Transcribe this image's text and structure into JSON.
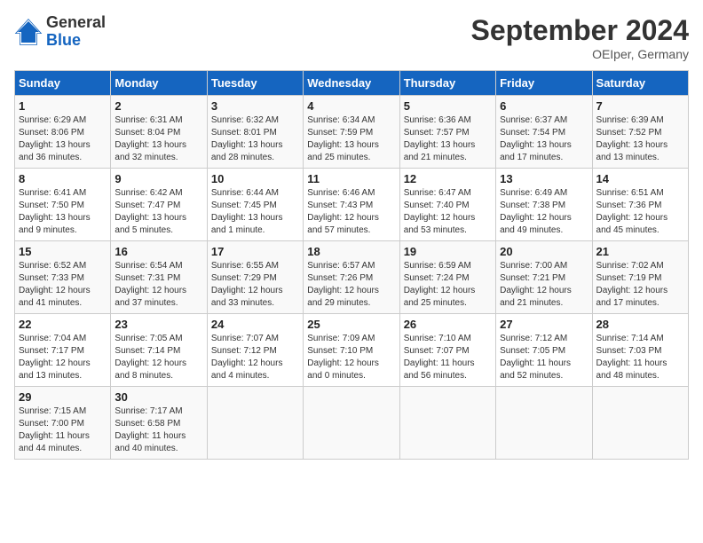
{
  "header": {
    "logo_line1": "General",
    "logo_line2": "Blue",
    "title": "September 2024",
    "subtitle": "OEIper, Germany"
  },
  "weekdays": [
    "Sunday",
    "Monday",
    "Tuesday",
    "Wednesday",
    "Thursday",
    "Friday",
    "Saturday"
  ],
  "weeks": [
    [
      {
        "day": "1",
        "sunrise": "6:29 AM",
        "sunset": "8:06 PM",
        "daylight": "13 hours and 36 minutes."
      },
      {
        "day": "2",
        "sunrise": "6:31 AM",
        "sunset": "8:04 PM",
        "daylight": "13 hours and 32 minutes."
      },
      {
        "day": "3",
        "sunrise": "6:32 AM",
        "sunset": "8:01 PM",
        "daylight": "13 hours and 28 minutes."
      },
      {
        "day": "4",
        "sunrise": "6:34 AM",
        "sunset": "7:59 PM",
        "daylight": "13 hours and 25 minutes."
      },
      {
        "day": "5",
        "sunrise": "6:36 AM",
        "sunset": "7:57 PM",
        "daylight": "13 hours and 21 minutes."
      },
      {
        "day": "6",
        "sunrise": "6:37 AM",
        "sunset": "7:54 PM",
        "daylight": "13 hours and 17 minutes."
      },
      {
        "day": "7",
        "sunrise": "6:39 AM",
        "sunset": "7:52 PM",
        "daylight": "13 hours and 13 minutes."
      }
    ],
    [
      {
        "day": "8",
        "sunrise": "6:41 AM",
        "sunset": "7:50 PM",
        "daylight": "13 hours and 9 minutes."
      },
      {
        "day": "9",
        "sunrise": "6:42 AM",
        "sunset": "7:47 PM",
        "daylight": "13 hours and 5 minutes."
      },
      {
        "day": "10",
        "sunrise": "6:44 AM",
        "sunset": "7:45 PM",
        "daylight": "13 hours and 1 minute."
      },
      {
        "day": "11",
        "sunrise": "6:46 AM",
        "sunset": "7:43 PM",
        "daylight": "12 hours and 57 minutes."
      },
      {
        "day": "12",
        "sunrise": "6:47 AM",
        "sunset": "7:40 PM",
        "daylight": "12 hours and 53 minutes."
      },
      {
        "day": "13",
        "sunrise": "6:49 AM",
        "sunset": "7:38 PM",
        "daylight": "12 hours and 49 minutes."
      },
      {
        "day": "14",
        "sunrise": "6:51 AM",
        "sunset": "7:36 PM",
        "daylight": "12 hours and 45 minutes."
      }
    ],
    [
      {
        "day": "15",
        "sunrise": "6:52 AM",
        "sunset": "7:33 PM",
        "daylight": "12 hours and 41 minutes."
      },
      {
        "day": "16",
        "sunrise": "6:54 AM",
        "sunset": "7:31 PM",
        "daylight": "12 hours and 37 minutes."
      },
      {
        "day": "17",
        "sunrise": "6:55 AM",
        "sunset": "7:29 PM",
        "daylight": "12 hours and 33 minutes."
      },
      {
        "day": "18",
        "sunrise": "6:57 AM",
        "sunset": "7:26 PM",
        "daylight": "12 hours and 29 minutes."
      },
      {
        "day": "19",
        "sunrise": "6:59 AM",
        "sunset": "7:24 PM",
        "daylight": "12 hours and 25 minutes."
      },
      {
        "day": "20",
        "sunrise": "7:00 AM",
        "sunset": "7:21 PM",
        "daylight": "12 hours and 21 minutes."
      },
      {
        "day": "21",
        "sunrise": "7:02 AM",
        "sunset": "7:19 PM",
        "daylight": "12 hours and 17 minutes."
      }
    ],
    [
      {
        "day": "22",
        "sunrise": "7:04 AM",
        "sunset": "7:17 PM",
        "daylight": "12 hours and 13 minutes."
      },
      {
        "day": "23",
        "sunrise": "7:05 AM",
        "sunset": "7:14 PM",
        "daylight": "12 hours and 8 minutes."
      },
      {
        "day": "24",
        "sunrise": "7:07 AM",
        "sunset": "7:12 PM",
        "daylight": "12 hours and 4 minutes."
      },
      {
        "day": "25",
        "sunrise": "7:09 AM",
        "sunset": "7:10 PM",
        "daylight": "12 hours and 0 minutes."
      },
      {
        "day": "26",
        "sunrise": "7:10 AM",
        "sunset": "7:07 PM",
        "daylight": "11 hours and 56 minutes."
      },
      {
        "day": "27",
        "sunrise": "7:12 AM",
        "sunset": "7:05 PM",
        "daylight": "11 hours and 52 minutes."
      },
      {
        "day": "28",
        "sunrise": "7:14 AM",
        "sunset": "7:03 PM",
        "daylight": "11 hours and 48 minutes."
      }
    ],
    [
      {
        "day": "29",
        "sunrise": "7:15 AM",
        "sunset": "7:00 PM",
        "daylight": "11 hours and 44 minutes."
      },
      {
        "day": "30",
        "sunrise": "7:17 AM",
        "sunset": "6:58 PM",
        "daylight": "11 hours and 40 minutes."
      },
      null,
      null,
      null,
      null,
      null
    ]
  ]
}
